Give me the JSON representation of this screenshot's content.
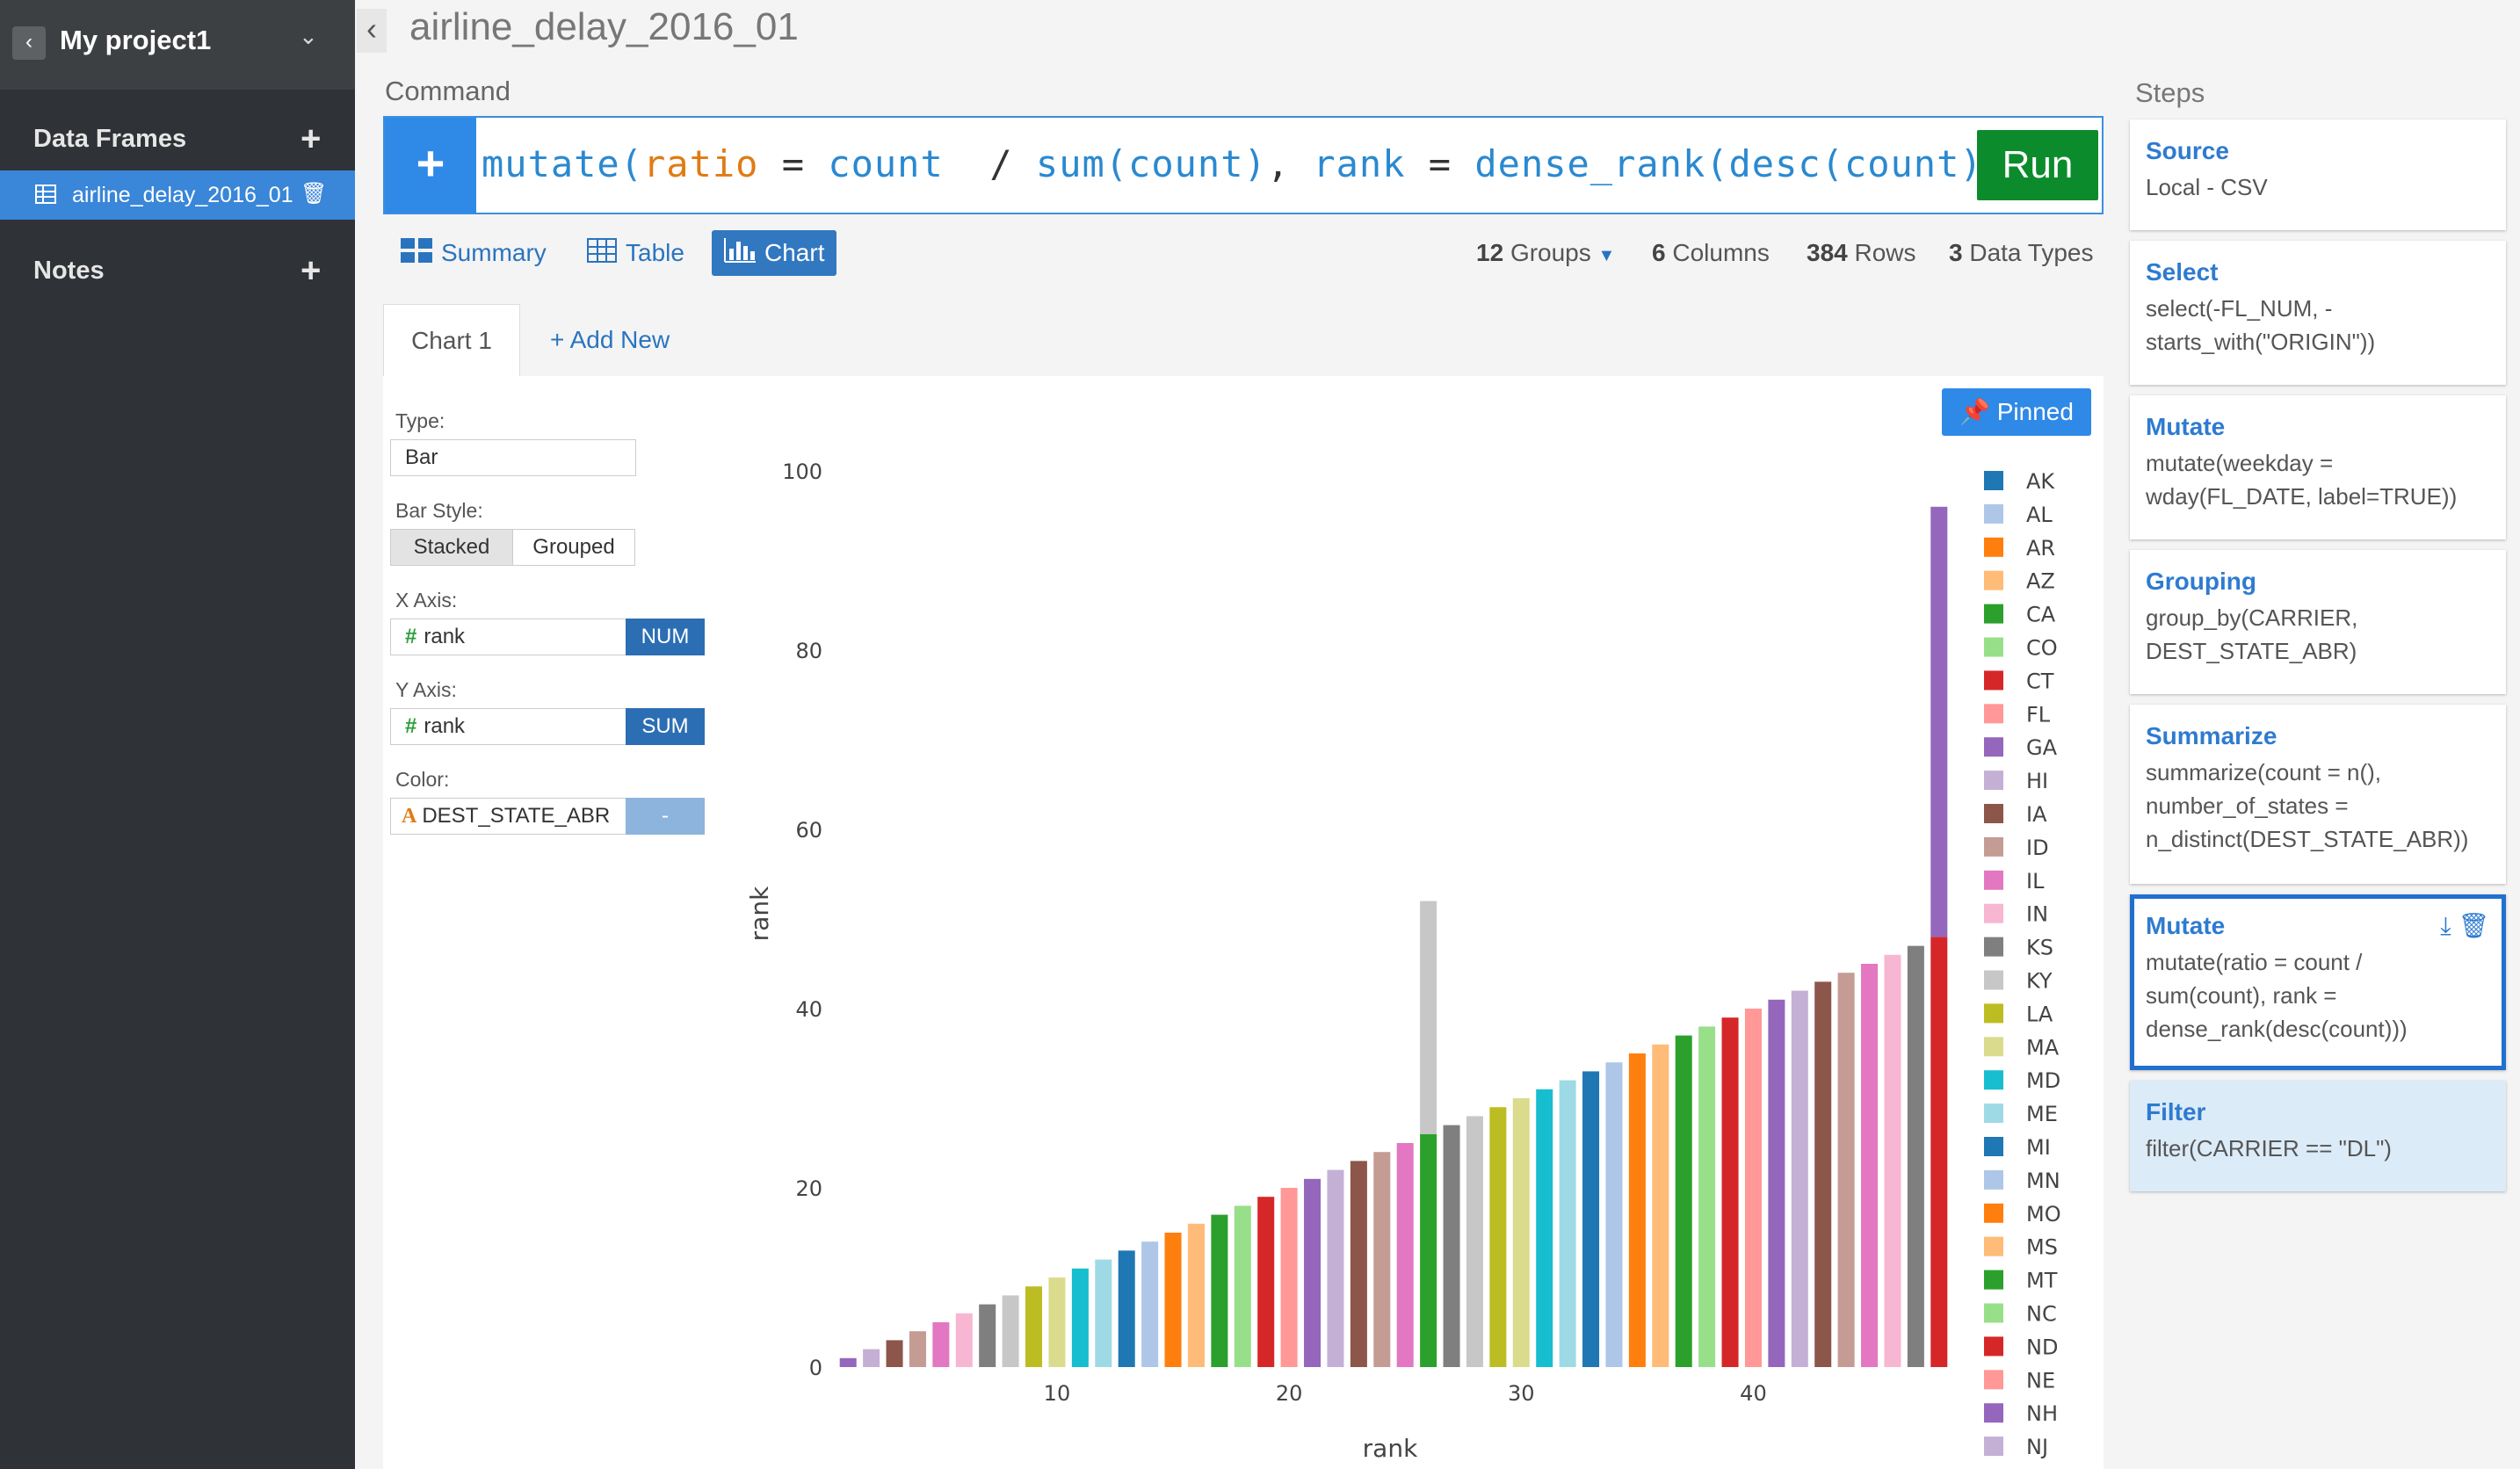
{
  "sidebar": {
    "project_name": "My project1",
    "data_frames_label": "Data Frames",
    "notes_label": "Notes",
    "data_frames": [
      {
        "name": "airline_delay_2016_01"
      }
    ]
  },
  "page": {
    "title": "airline_delay_2016_01",
    "command_label": "Command",
    "command_parts": [
      {
        "t": "mutate(",
        "c": "fn"
      },
      {
        "t": "ratio",
        "c": "arg"
      },
      {
        "t": " = ",
        "c": "op"
      },
      {
        "t": "count",
        "c": "var"
      },
      {
        "t": "  / ",
        "c": "op"
      },
      {
        "t": "sum(count)",
        "c": "fn"
      },
      {
        "t": ", ",
        "c": "op"
      },
      {
        "t": "rank",
        "c": "var"
      },
      {
        "t": " = ",
        "c": "op"
      },
      {
        "t": "dense_rank(desc(count)))",
        "c": "fn"
      }
    ],
    "run_label": "Run"
  },
  "views": {
    "summary": "Summary",
    "table": "Table",
    "chart": "Chart",
    "groups_count": "12",
    "groups_label": "Groups",
    "columns_count": "6",
    "columns_label": "Columns",
    "rows_count": "384",
    "rows_label": "Rows",
    "types_count": "3",
    "types_label": "Data Types"
  },
  "chart_tabs": {
    "active": "Chart 1",
    "add_new": "+ Add New",
    "pinned": "Pinned"
  },
  "config": {
    "type_label": "Type:",
    "type_value": "Bar",
    "bar_style_label": "Bar Style:",
    "stacked": "Stacked",
    "grouped": "Grouped",
    "x_axis_label": "X Axis:",
    "x_value": "rank",
    "x_tag": "NUM",
    "y_axis_label": "Y Axis:",
    "y_value": "rank",
    "y_tag": "SUM",
    "color_label": "Color:",
    "color_value": "DEST_STATE_ABR",
    "color_tag": "-"
  },
  "steps_label": "Steps",
  "steps": [
    {
      "title": "Source",
      "body": "Local - CSV"
    },
    {
      "title": "Select",
      "body": "select(-FL_NUM, -\nstarts_with(\"ORIGIN\"))"
    },
    {
      "title": "Mutate",
      "body": "mutate(weekday =\nwday(FL_DATE, label=TRUE))"
    },
    {
      "title": "Grouping",
      "body": "group_by(CARRIER,\nDEST_STATE_ABR)"
    },
    {
      "title": "Summarize",
      "body": "summarize(count = n(),\nnumber_of_states =\nn_distinct(DEST_STATE_ABR))"
    },
    {
      "title": "Mutate",
      "body": "mutate(ratio = count /\nsum(count), rank =\ndense_rank(desc(count)))"
    },
    {
      "title": "Filter",
      "body": "filter(CARRIER == \"DL\")"
    }
  ],
  "chart_data": {
    "type": "bar",
    "stacked": true,
    "xlabel": "rank",
    "ylabel": "rank",
    "ylim": [
      0,
      100
    ],
    "x_ticks": [
      10,
      20,
      30,
      40
    ],
    "y_ticks": [
      0,
      20,
      40,
      60,
      80,
      100
    ],
    "x": [
      1,
      2,
      3,
      4,
      5,
      6,
      7,
      8,
      9,
      10,
      11,
      12,
      13,
      14,
      15,
      16,
      17,
      18,
      19,
      20,
      21,
      22,
      23,
      24,
      25,
      26,
      27,
      28,
      29,
      30,
      31,
      32,
      33,
      34,
      35,
      36,
      37,
      38,
      39,
      40,
      41,
      42,
      43,
      44,
      45,
      46,
      47,
      48
    ],
    "values": [
      1,
      2,
      3,
      4,
      5,
      6,
      7,
      8,
      9,
      10,
      11,
      12,
      13,
      14,
      15,
      16,
      17,
      18,
      19,
      20,
      21,
      22,
      23,
      24,
      25,
      52,
      27,
      28,
      29,
      30,
      31,
      32,
      33,
      34,
      35,
      36,
      37,
      38,
      39,
      40,
      41,
      42,
      43,
      44,
      45,
      46,
      47,
      96
    ],
    "stack_split": {
      "26": [
        26,
        26
      ],
      "48": [
        48,
        48
      ]
    },
    "legend": [
      "AK",
      "AL",
      "AR",
      "AZ",
      "CA",
      "CO",
      "CT",
      "FL",
      "GA",
      "HI",
      "IA",
      "ID",
      "IL",
      "IN",
      "KS",
      "KY",
      "LA",
      "MA",
      "MD",
      "ME",
      "MI",
      "MN",
      "MO",
      "MS",
      "MT",
      "NC",
      "ND",
      "NE",
      "NH",
      "NJ"
    ],
    "palette": [
      "#1f77b4",
      "#aec7e8",
      "#ff7f0e",
      "#ffbb78",
      "#2ca02c",
      "#98df8a",
      "#d62728",
      "#ff9896",
      "#9467bd",
      "#c5b0d5",
      "#8c564b",
      "#c49c94",
      "#e377c2",
      "#f7b6d2",
      "#7f7f7f",
      "#c7c7c7",
      "#bcbd22",
      "#dbdb8d",
      "#17becf",
      "#9edae5"
    ],
    "grid": false,
    "legend_position": "right"
  }
}
